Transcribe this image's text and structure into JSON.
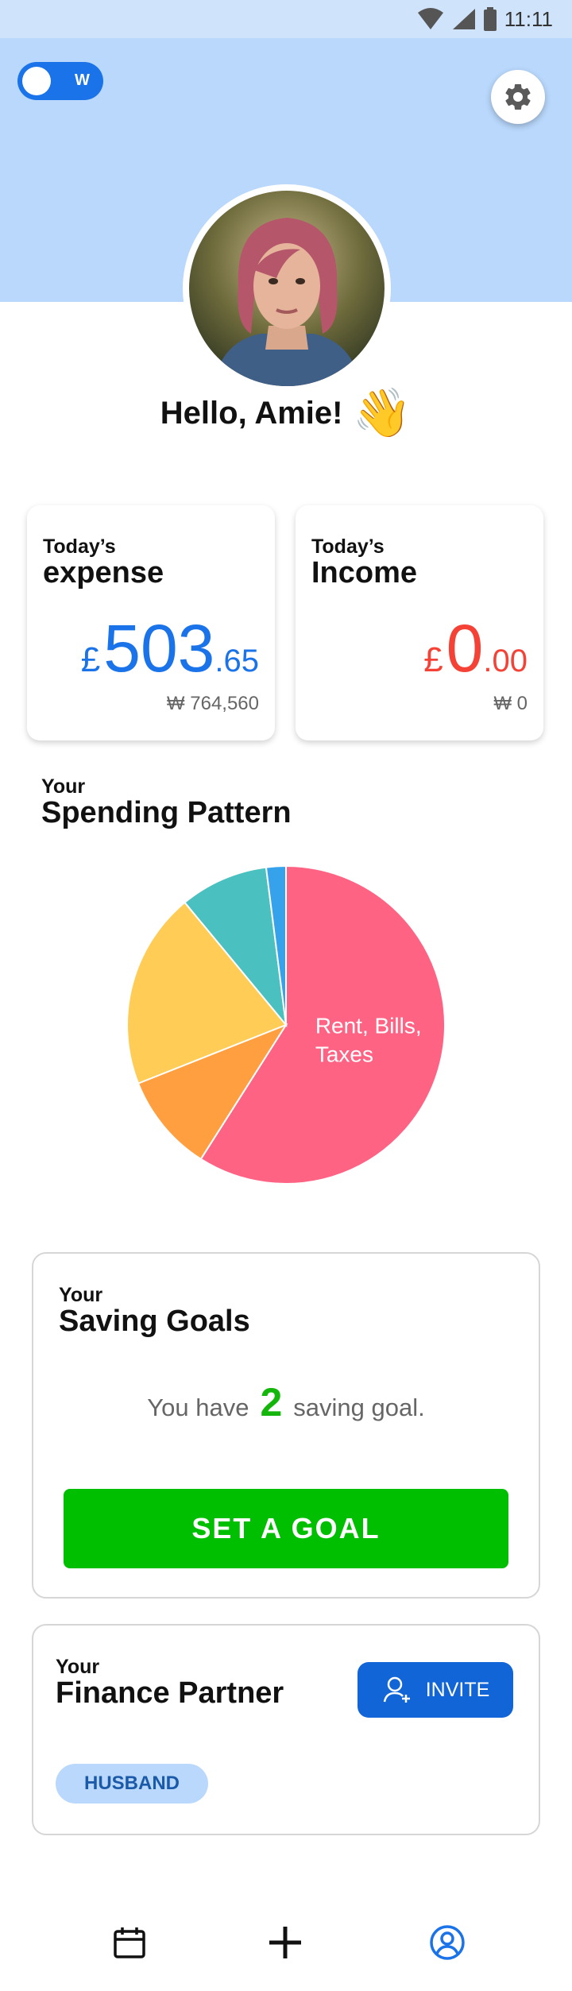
{
  "status_bar": {
    "time": "11:11"
  },
  "header": {
    "toggle_label": "W",
    "toggle_on": true
  },
  "greeting": {
    "text": "Hello, Amie!",
    "emoji": "👋"
  },
  "expense_card": {
    "label_small": "Today’s",
    "label_big": "expense",
    "currency": "£",
    "integer": "503",
    "decimal": ".65",
    "converted": "₩ 764,560",
    "color": "#1a73e8"
  },
  "income_card": {
    "label_small": "Today’s",
    "label_big": "Income",
    "currency": "£",
    "integer": "0",
    "decimal": ".00",
    "converted": "₩ 0",
    "color": "#f44336"
  },
  "spending": {
    "label_small": "Your",
    "label_big": "Spending Pattern"
  },
  "chart_data": {
    "type": "pie",
    "slices": [
      {
        "label": "Rent, Bills, Taxes",
        "value": 59,
        "color": "#ff6384"
      },
      {
        "label": "",
        "value": 10,
        "color": "#ff9f40"
      },
      {
        "label": "",
        "value": 20,
        "color": "#ffcd56"
      },
      {
        "label": "",
        "value": 9,
        "color": "#4bc0c0"
      },
      {
        "label": "",
        "value": 2,
        "color": "#36a2eb"
      }
    ]
  },
  "saving_goals": {
    "label_small": "Your",
    "label_big": "Saving Goals",
    "prefix": "You have",
    "count": "2",
    "suffix": "saving goal.",
    "button_label": "SET A GOAL"
  },
  "finance_partner": {
    "label_small": "Your",
    "label_big": "Finance Partner",
    "invite_label": "INVITE",
    "chip_label": "HUSBAND"
  },
  "bottom_nav": {
    "items": [
      {
        "icon": "calendar-icon"
      },
      {
        "icon": "plus-icon"
      },
      {
        "icon": "profile-icon"
      }
    ]
  }
}
